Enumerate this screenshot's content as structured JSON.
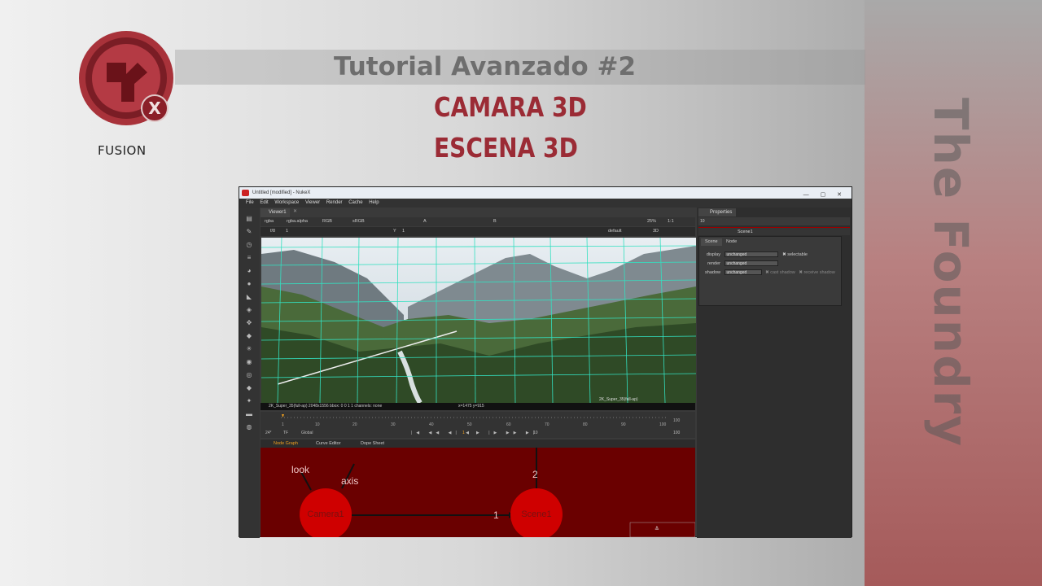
{
  "slide": {
    "title": "Tutorial Avanzado #2",
    "subtitle1": "CAMARA 3D",
    "subtitle2": "ESCENA  3D",
    "side_text": "The Foundry",
    "logo_text": "FUSION",
    "colors": {
      "accent": "#9b2b35",
      "title": "#6e6e6e"
    }
  },
  "window": {
    "title": "Untitled [modified] - NukeX",
    "menu": [
      "File",
      "Edit",
      "Workspace",
      "Viewer",
      "Render",
      "Cache",
      "Help"
    ],
    "viewer_tab": "Viewer1",
    "viewer_controls": {
      "channels": "rgba",
      "alpha": "rgba.alpha",
      "colorspace_a": "RGB",
      "lut": "sRGB",
      "input_a": "A",
      "input_b": "B",
      "zoom": "25%",
      "ratio": "1:1",
      "mode": "3D",
      "fstop": "f/8",
      "frame": "1",
      "y_label": "Y",
      "y_value": "1",
      "camera": "default"
    },
    "viewer_status": {
      "format": "2K_Super_35(full-ap) 2048x1556  bbox: 0 0 1 1 channels: none",
      "coords": "x=1475 y=915",
      "overlay": "2K_Super_35(full-ap)"
    },
    "timeline": {
      "ticks": [
        "1",
        "10",
        "20",
        "30",
        "40",
        "50",
        "60",
        "70",
        "80",
        "90",
        "100"
      ],
      "end": "100",
      "fps": "24*",
      "tf": "TF",
      "scope": "Global",
      "frame": "1",
      "step": "10",
      "end2": "100"
    },
    "tabs": [
      "Node Graph",
      "Curve Editor",
      "Dope Sheet"
    ],
    "node_graph": {
      "nodes": [
        "Camera1",
        "Scene1"
      ],
      "labels": {
        "look": "look",
        "axis": "axis",
        "input1": "1",
        "input2": "2"
      }
    },
    "properties": {
      "tab": "Properties",
      "max_panels": "10",
      "node_name": "Scene1",
      "subtabs": [
        "Scene",
        "Node"
      ],
      "rows": [
        {
          "label": "display",
          "value": "unchanged",
          "extra": "selectable"
        },
        {
          "label": "render",
          "value": "unchanged",
          "extra": ""
        },
        {
          "label": "shadow",
          "value": "unchanged",
          "extra": "cast shadow",
          "extra2": "receive shadow"
        }
      ]
    }
  }
}
